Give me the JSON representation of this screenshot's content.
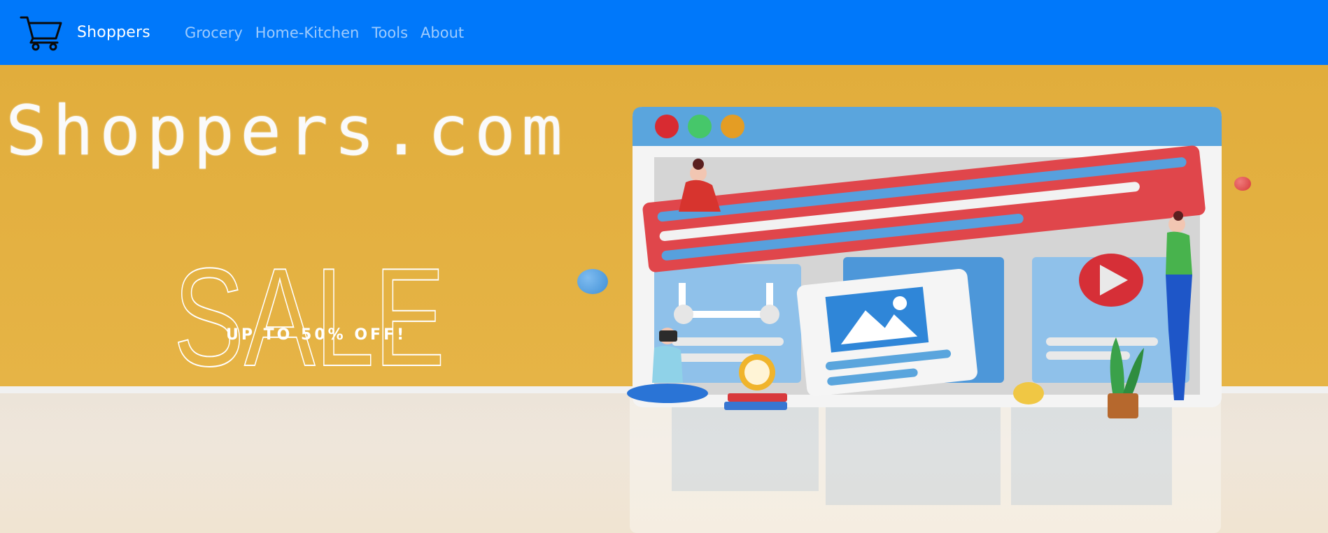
{
  "navbar": {
    "brand_icon": "cart-icon",
    "brand_label": "Shoppers",
    "links": [
      {
        "label": "Grocery"
      },
      {
        "label": "Home-Kitchen"
      },
      {
        "label": "Tools"
      },
      {
        "label": "About"
      }
    ],
    "background": "#0078fa"
  },
  "hero": {
    "title": "Shoppers.com",
    "sale_label": "SALE",
    "offer_label": "UP TO 50% OFF!",
    "background": "#e3b03f"
  }
}
